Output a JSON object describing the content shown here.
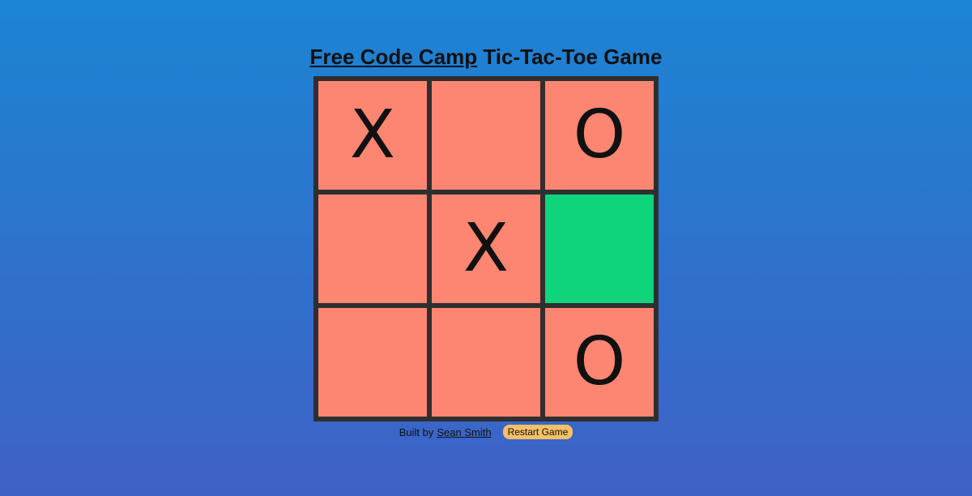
{
  "header": {
    "link_text": "Free Code Camp",
    "title_rest": " Tic-Tac-Toe Game"
  },
  "board": {
    "cells": [
      "X",
      "",
      "O",
      "",
      "X",
      "",
      "",
      "",
      "O"
    ],
    "highlighted_cell_index": 5,
    "colors": {
      "cell": "#fd8673",
      "highlight": "#10d47c",
      "border": "#2f2f2f"
    }
  },
  "footer": {
    "built_by": "Built by",
    "author_name": "Sean Smith",
    "restart_label": "Restart Game",
    "restart_color": "#f6c065"
  },
  "background": {
    "gradient_top": "#1c84d4",
    "gradient_bottom": "#3f61c6"
  }
}
